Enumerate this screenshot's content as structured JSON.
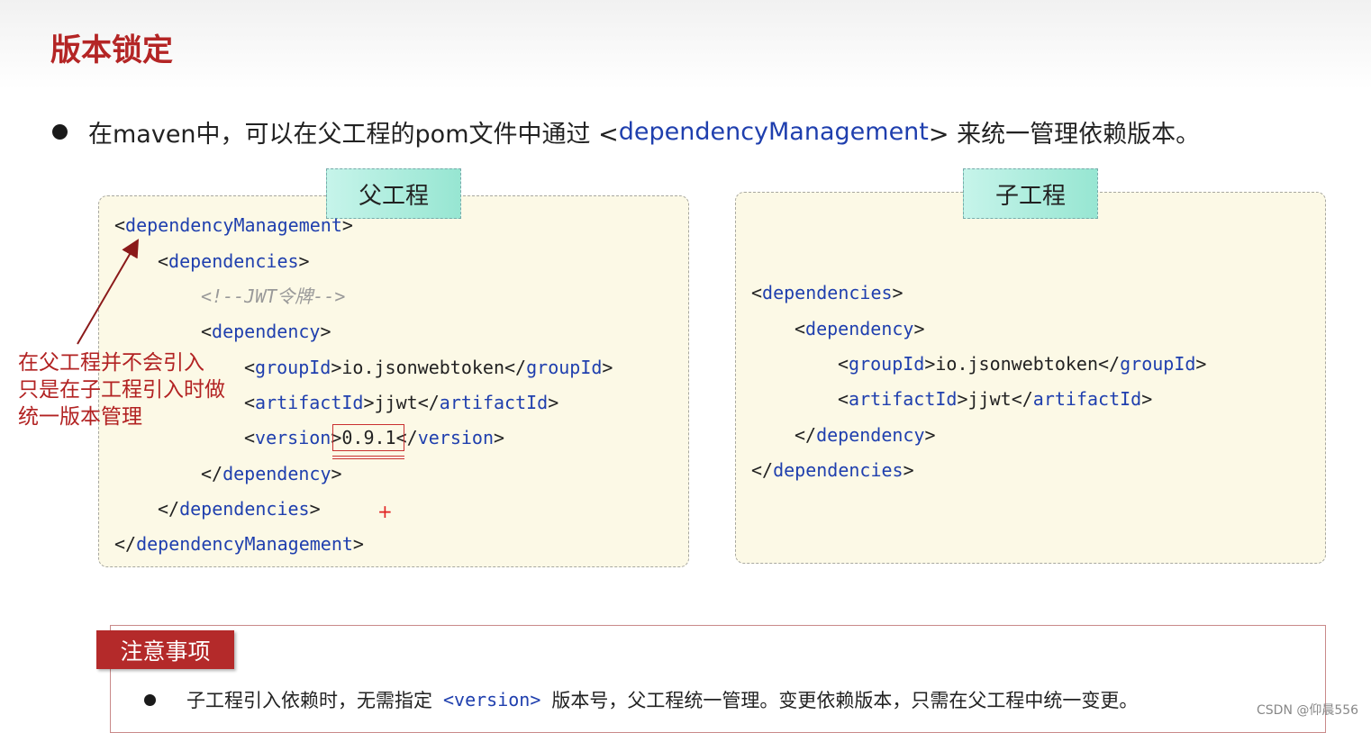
{
  "title": "版本锁定",
  "intro": {
    "prefix": "在maven中，可以在父工程的pom文件中通过 <",
    "keyword": "dependencyManagement",
    "suffix": "> 来统一管理依赖版本。"
  },
  "parent_panel": {
    "tab_label": "父工程",
    "lines": {
      "dm_open_tag": "dependencyManagement",
      "deps_open_tag": "dependencies",
      "comment": "<!--JWT令牌-->",
      "dep_open_tag": "dependency",
      "group_tag": "groupId",
      "group_value": "io.jsonwebtoken",
      "artifact_tag": "artifactId",
      "artifact_value": "jjwt",
      "version_tag": "version",
      "version_value": "0.9.1",
      "dep_close_tag": "dependency",
      "deps_close_tag": "dependencies",
      "dm_close_tag": "dependencyManagement"
    }
  },
  "child_panel": {
    "tab_label": "子工程",
    "lines": {
      "deps_open_tag": "dependencies",
      "dep_open_tag": "dependency",
      "group_tag": "groupId",
      "group_value": "io.jsonwebtoken",
      "artifact_tag": "artifactId",
      "artifact_value": "jjwt",
      "dep_close_tag": "dependency",
      "deps_close_tag": "dependencies"
    }
  },
  "annotation": {
    "line1": "在父工程并不会引入",
    "line2": "只是在子工程引入时做",
    "line3": "统一版本管理"
  },
  "plus_mark": "+",
  "note": {
    "label": "注意事项",
    "prefix": "子工程引入依赖时，无需指定",
    "code": "<version>",
    "suffix": "版本号，父工程统一管理。变更依赖版本，只需在父工程中统一变更。"
  },
  "watermark": "CSDN @仰晨556",
  "colors": {
    "title": "#b42525",
    "keyword": "#1f3fae",
    "panel_bg": "#fcf9e6",
    "tab_bg": "#97e6d2",
    "annotation": "#b22222",
    "note_label_bg": "#b42a2a"
  }
}
